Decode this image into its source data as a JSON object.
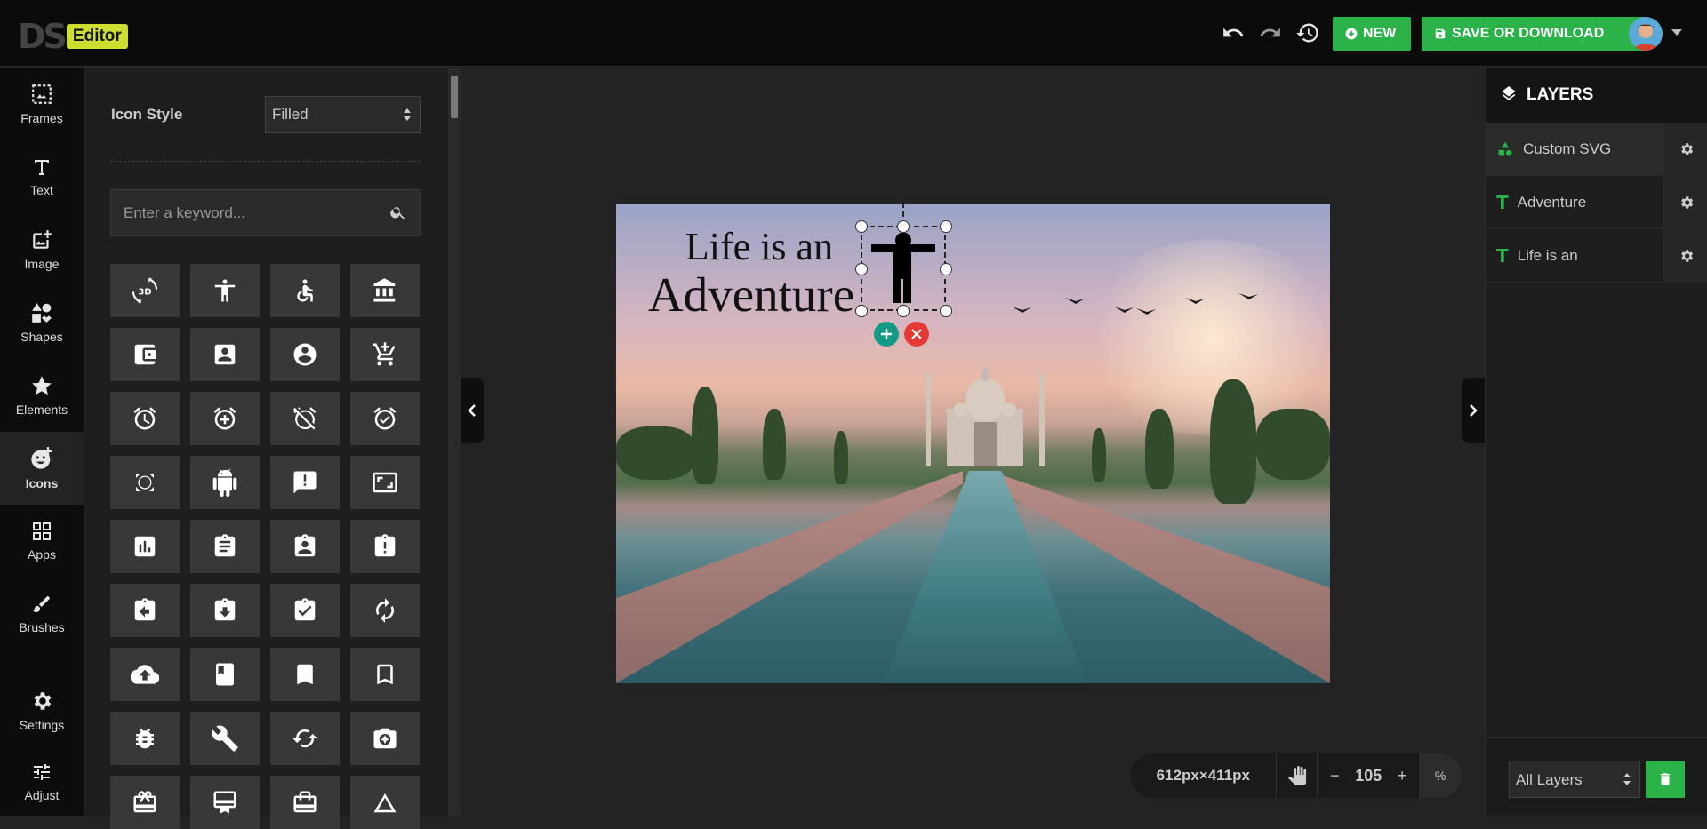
{
  "header": {
    "logo_ds": "DS",
    "logo_editor": "Editor",
    "new_label": "NEW",
    "save_label": "SAVE OR DOWNLOAD",
    "accent": "#2bb34a",
    "logo_accent": "#cde032"
  },
  "leftnav": {
    "items": [
      {
        "label": "Frames",
        "icon": "frame-icon"
      },
      {
        "label": "Text",
        "icon": "text-icon"
      },
      {
        "label": "Image",
        "icon": "image-add-icon"
      },
      {
        "label": "Shapes",
        "icon": "shapes-icon"
      },
      {
        "label": "Elements",
        "icon": "star-icon"
      },
      {
        "label": "Icons",
        "icon": "emoji-icon"
      },
      {
        "label": "Apps",
        "icon": "apps-grid-icon"
      },
      {
        "label": "Brushes",
        "icon": "brush-icon"
      },
      {
        "label": "Settings",
        "icon": "gear-icon"
      },
      {
        "label": "Adjust",
        "icon": "sliders-icon"
      }
    ],
    "active": "Icons"
  },
  "panel": {
    "icon_style_label": "Icon Style",
    "icon_style_value": "Filled",
    "search_placeholder": "Enter a keyword...",
    "icons": [
      "3d-rotation-icon",
      "accessibility-icon",
      "accessible-icon",
      "account-balance-icon",
      "account-balance-wallet-icon",
      "account-box-icon",
      "account-circle-icon",
      "add-shopping-cart-icon",
      "alarm-icon",
      "alarm-add-icon",
      "alarm-off-icon",
      "alarm-on-icon",
      "all-out-icon",
      "android-icon",
      "announcement-icon",
      "aspect-ratio-icon",
      "assessment-icon",
      "assignment-icon",
      "assignment-ind-icon",
      "assignment-late-icon",
      "assignment-return-icon",
      "assignment-returned-icon",
      "assignment-turned-in-icon",
      "autorenew-icon",
      "backup-icon",
      "book-icon",
      "bookmark-icon",
      "bookmark-border-icon",
      "bug-report-icon",
      "build-icon",
      "cached-icon",
      "camera-enhance-icon",
      "card-giftcard-icon",
      "card-membership-icon",
      "card-travel-icon",
      "change-history-icon"
    ]
  },
  "canvas": {
    "caption_line1": "Life is an",
    "caption_line2": "Adventure"
  },
  "layers": {
    "title": "LAYERS",
    "items": [
      {
        "label": "Custom SVG",
        "type": "svg-layer-icon",
        "selected": true
      },
      {
        "label": "Adventure",
        "type": "text-layer-icon",
        "selected": false
      },
      {
        "label": "Life is an",
        "type": "text-layer-icon",
        "selected": false
      }
    ],
    "filter_value": "All Layers"
  },
  "zoom": {
    "size": "612px×411px",
    "minus": "−",
    "value": "105",
    "plus": "+",
    "percent": "%"
  }
}
